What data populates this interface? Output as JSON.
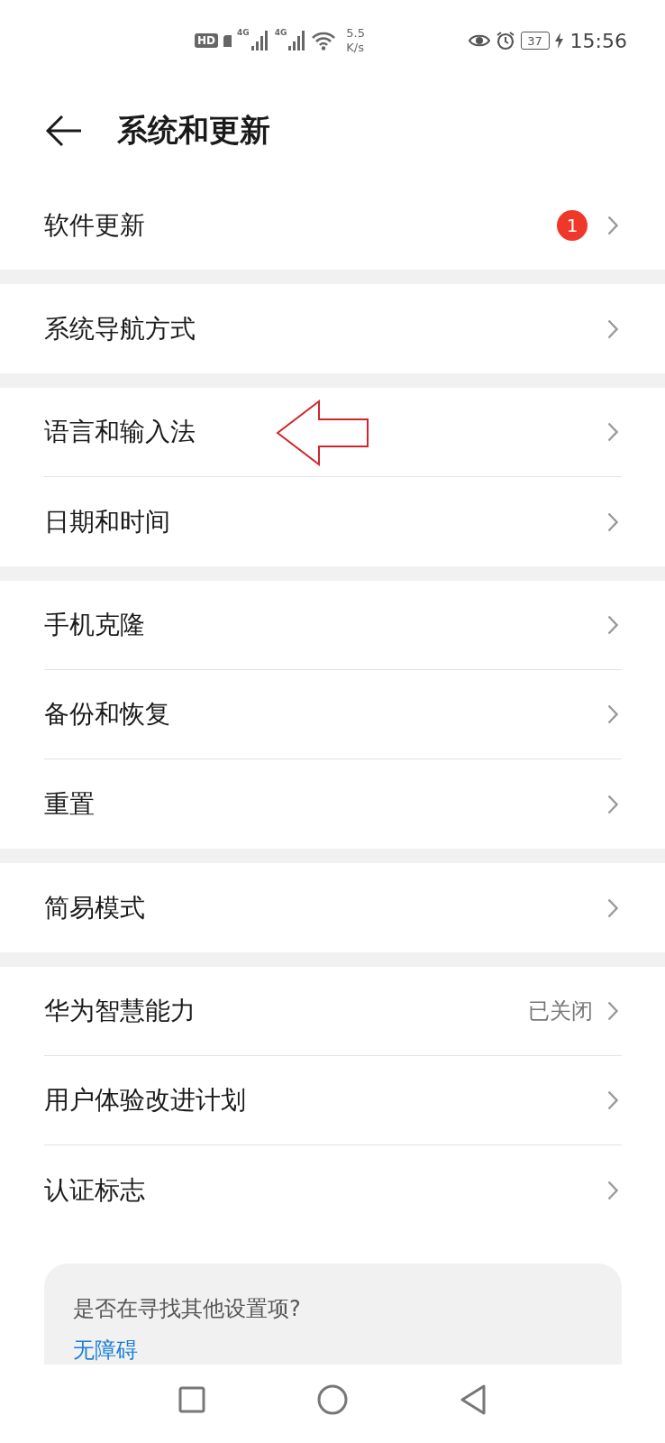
{
  "status_bar": {
    "hd": "HD",
    "sims": [
      "4G",
      "4G"
    ],
    "speed_value": "5.5",
    "speed_unit": "K/s",
    "battery": "37",
    "time": "15:56"
  },
  "header": {
    "title": "系统和更新"
  },
  "groups": [
    {
      "items": [
        {
          "label": "软件更新",
          "badge": "1"
        }
      ]
    },
    {
      "items": [
        {
          "label": "系统导航方式"
        }
      ]
    },
    {
      "items": [
        {
          "label": "语言和输入法",
          "annotated": true
        },
        {
          "label": "日期和时间"
        }
      ]
    },
    {
      "items": [
        {
          "label": "手机克隆"
        },
        {
          "label": "备份和恢复"
        },
        {
          "label": "重置"
        }
      ]
    },
    {
      "items": [
        {
          "label": "简易模式"
        }
      ]
    },
    {
      "items": [
        {
          "label": "华为智慧能力",
          "value": "已关闭"
        },
        {
          "label": "用户体验改进计划"
        },
        {
          "label": "认证标志"
        }
      ]
    }
  ],
  "suggestion_card": {
    "question": "是否在寻找其他设置项?",
    "link": "无障碍"
  }
}
